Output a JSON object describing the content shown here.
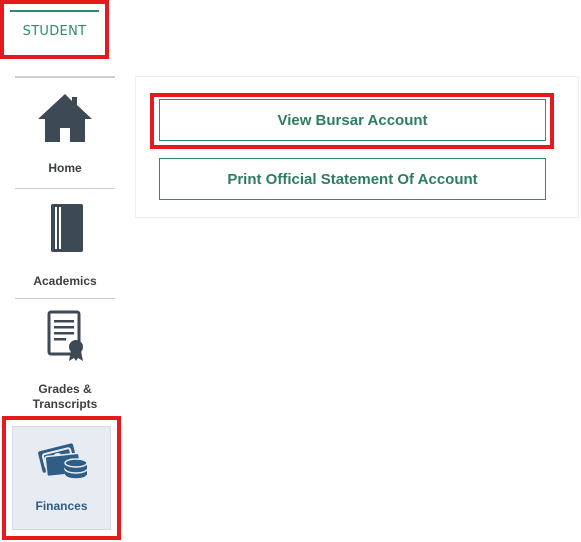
{
  "header": {
    "student_tab_label": "STUDENT"
  },
  "sidebar": {
    "items": [
      {
        "label": "Home",
        "icon": "home-icon"
      },
      {
        "label": "Academics",
        "icon": "notebook-icon"
      },
      {
        "label": "Grades &\nTranscripts",
        "icon": "certificate-icon"
      },
      {
        "label": "Finances",
        "icon": "money-coins-icon",
        "active": true
      }
    ]
  },
  "main": {
    "buttons": [
      {
        "label": "View Bursar Account"
      },
      {
        "label": "Print Official Statement Of Account"
      }
    ]
  },
  "colors": {
    "accent_green": "#2e8b6f",
    "highlight_red": "#e8191c",
    "icon_dark": "#3d4a55",
    "active_bg": "#e7ecf3",
    "active_icon": "#2f5d85"
  }
}
